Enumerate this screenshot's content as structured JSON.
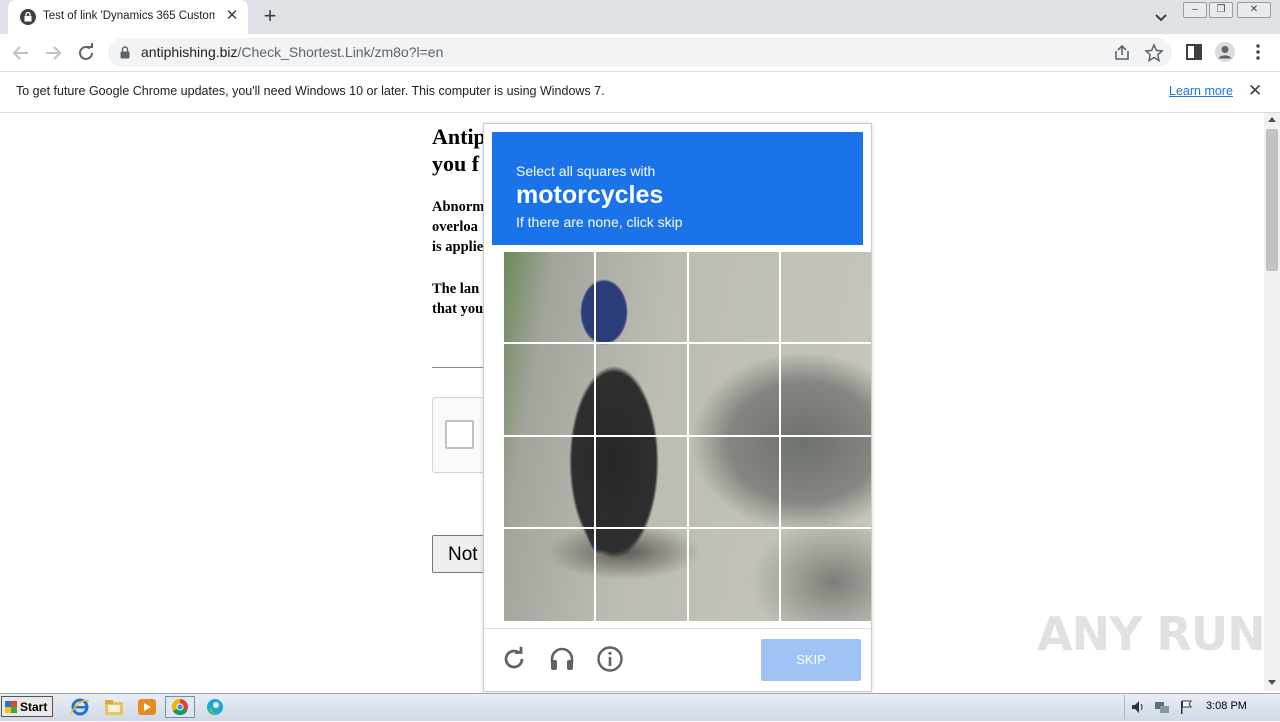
{
  "browser": {
    "tab_title": "Test of link 'Dynamics 365 Customer",
    "url_domain": "antiphishing.biz",
    "url_path": "/Check_Shortest.Link/zm8o?l=en"
  },
  "infobar": {
    "message": "To get future Google Chrome updates, you'll need Windows 10 or later. This computer is using Windows 7.",
    "learn_more": "Learn more"
  },
  "page": {
    "heading": "Antip\nyou f",
    "paragraph1": "Abnorm\noverloa\nis applie",
    "paragraph2": "The lan\nthat you",
    "not_button": "Not"
  },
  "captcha": {
    "instruction": "Select all squares with",
    "target": "motorcycles",
    "hint": "If there are none, click skip",
    "skip_label": "SKIP",
    "header_color": "#1a73e8",
    "skip_color": "#9ec3f4"
  },
  "taskbar": {
    "start_label": "Start",
    "clock": "3:08 PM"
  },
  "watermark": "ANY RUN"
}
